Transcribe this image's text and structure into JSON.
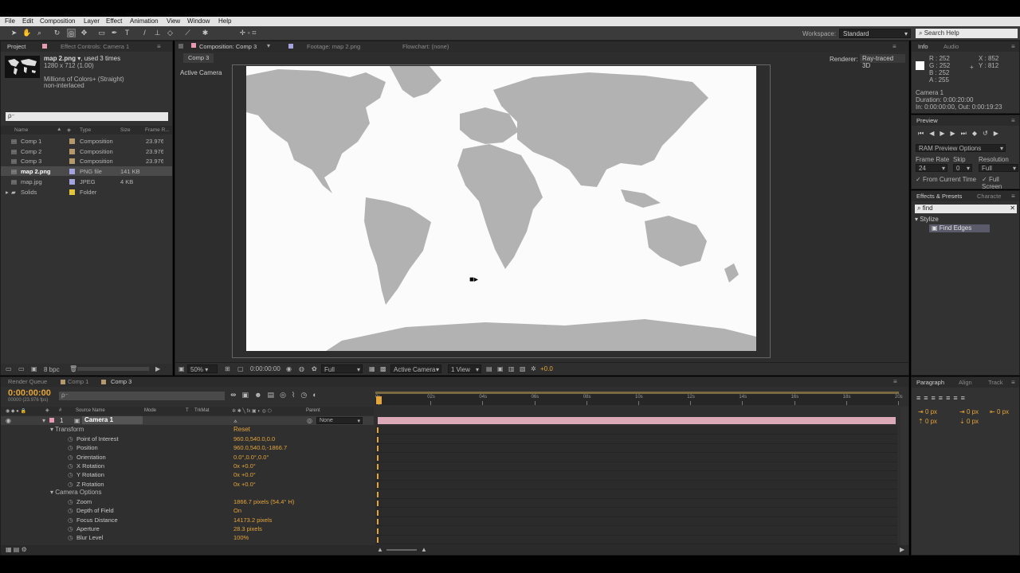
{
  "menu": [
    "File",
    "Edit",
    "Composition",
    "Layer",
    "Effect",
    "Animation",
    "View",
    "Window",
    "Help"
  ],
  "toolbar": {
    "workspace_label": "Workspace:",
    "workspace_value": "Standard",
    "search_placeholder": "Search Help"
  },
  "project": {
    "tabs": [
      "Project",
      "Effect Controls: Camera 1"
    ],
    "file_name": "map 2.png",
    "used": ", used 3 times",
    "dims": "1280 x 712 (1.00)",
    "colors": "Millions of Colors+ (Straight)",
    "interlace": "non-interlaced",
    "search_placeholder": "ρ⁻",
    "columns": [
      "Name",
      "Type",
      "Size",
      "Frame R..."
    ],
    "rows": [
      {
        "name": "Comp 1",
        "type": "Composition",
        "size": "",
        "fr": "23.976",
        "color": "#b49a6a"
      },
      {
        "name": "Comp 2",
        "type": "Composition",
        "size": "",
        "fr": "23.976",
        "color": "#b49a6a"
      },
      {
        "name": "Comp 3",
        "type": "Composition",
        "size": "",
        "fr": "23.976",
        "color": "#b49a6a"
      },
      {
        "name": "map 2.png",
        "type": "PNG file",
        "size": "141 KB",
        "fr": "",
        "color": "#a4a4e0"
      },
      {
        "name": "map.jpg",
        "type": "JPEG",
        "size": "4 KB",
        "fr": "",
        "color": "#a4a4e0"
      },
      {
        "name": "Solids",
        "type": "Folder",
        "size": "",
        "fr": "",
        "color": "#e3c53a"
      }
    ],
    "bpc": "8 bpc"
  },
  "comp": {
    "tabs": [
      "Composition: Comp 3",
      "Footage: map 2.png",
      "Flowchart: (none)"
    ],
    "subtab": "Comp 3",
    "renderer_label": "Renderer:",
    "renderer_value": "Ray-traced 3D",
    "view_label": "Active Camera",
    "footer": {
      "zoom": "50%",
      "time": "0:00:00:00",
      "quality": "Full",
      "camera": "Active Camera",
      "views": "1 View",
      "exposure": "+0.0"
    }
  },
  "info": {
    "tabs": [
      "Info",
      "Audio"
    ],
    "r": "R : 252",
    "g": "G : 252",
    "b": "B : 252",
    "a": "A : 255",
    "x": "X : 852",
    "y": "Y : 812",
    "layer": "Camera 1",
    "duration": "Duration: 0:00:20:00",
    "inout": "In: 0:00:00:00, Out: 0:00:19:23"
  },
  "preview": {
    "title": "Preview",
    "ram": "RAM Preview Options",
    "frame_rate_label": "Frame Rate",
    "skip_label": "Skip",
    "resolution_label": "Resolution",
    "frame_rate": "24",
    "skip": "0",
    "resolution": "Full",
    "from_current": "From Current Time",
    "full_screen": "Full Screen"
  },
  "effects": {
    "tabs": [
      "Effects & Presets",
      "Characte"
    ],
    "search": "find",
    "category": "Stylize",
    "item": "Find Edges"
  },
  "timeline": {
    "tabs": [
      "Render Queue",
      "Comp 1",
      "Comp 3"
    ],
    "time": "0:00:00:00",
    "fps": "00000 (23.976 fps)",
    "search_placeholder": "ρ⁻",
    "ruler": [
      "0s",
      "02s",
      "04s",
      "06s",
      "08s",
      "10s",
      "12s",
      "14s",
      "16s",
      "18s",
      "20s"
    ],
    "col_source": "Source Name",
    "col_mode": "Mode",
    "col_t": "T",
    "col_trkmat": "TrkMat",
    "col_parent": "Parent",
    "layer_num": "1",
    "layer_name": "Camera 1",
    "parent": "None",
    "transform": "Transform",
    "reset": "Reset",
    "props": [
      {
        "name": "Point of Interest",
        "value": "960.0,540.0,0.0"
      },
      {
        "name": "Position",
        "value": "960.0,540.0,-1866.7"
      },
      {
        "name": "Orientation",
        "value": "0.0°,0.0°,0.0°"
      },
      {
        "name": "X Rotation",
        "value": "0x +0.0°"
      },
      {
        "name": "Y Rotation",
        "value": "0x +0.0°"
      },
      {
        "name": "Z Rotation",
        "value": "0x +0.0°"
      }
    ],
    "camera_options": "Camera Options",
    "cam_props": [
      {
        "name": "Zoom",
        "value": "1866.7 pixels (54.4° H)"
      },
      {
        "name": "Depth of Field",
        "value": "On"
      },
      {
        "name": "Focus Distance",
        "value": "14173.2 pixels"
      },
      {
        "name": "Aperture",
        "value": "28.3 pixels"
      },
      {
        "name": "Blur Level",
        "value": "100%"
      }
    ]
  },
  "paragraph": {
    "tabs": [
      "Paragraph",
      "Align",
      "Track"
    ],
    "px": [
      "0 px",
      "0 px",
      "0 px",
      "0 px",
      "0 px"
    ]
  }
}
